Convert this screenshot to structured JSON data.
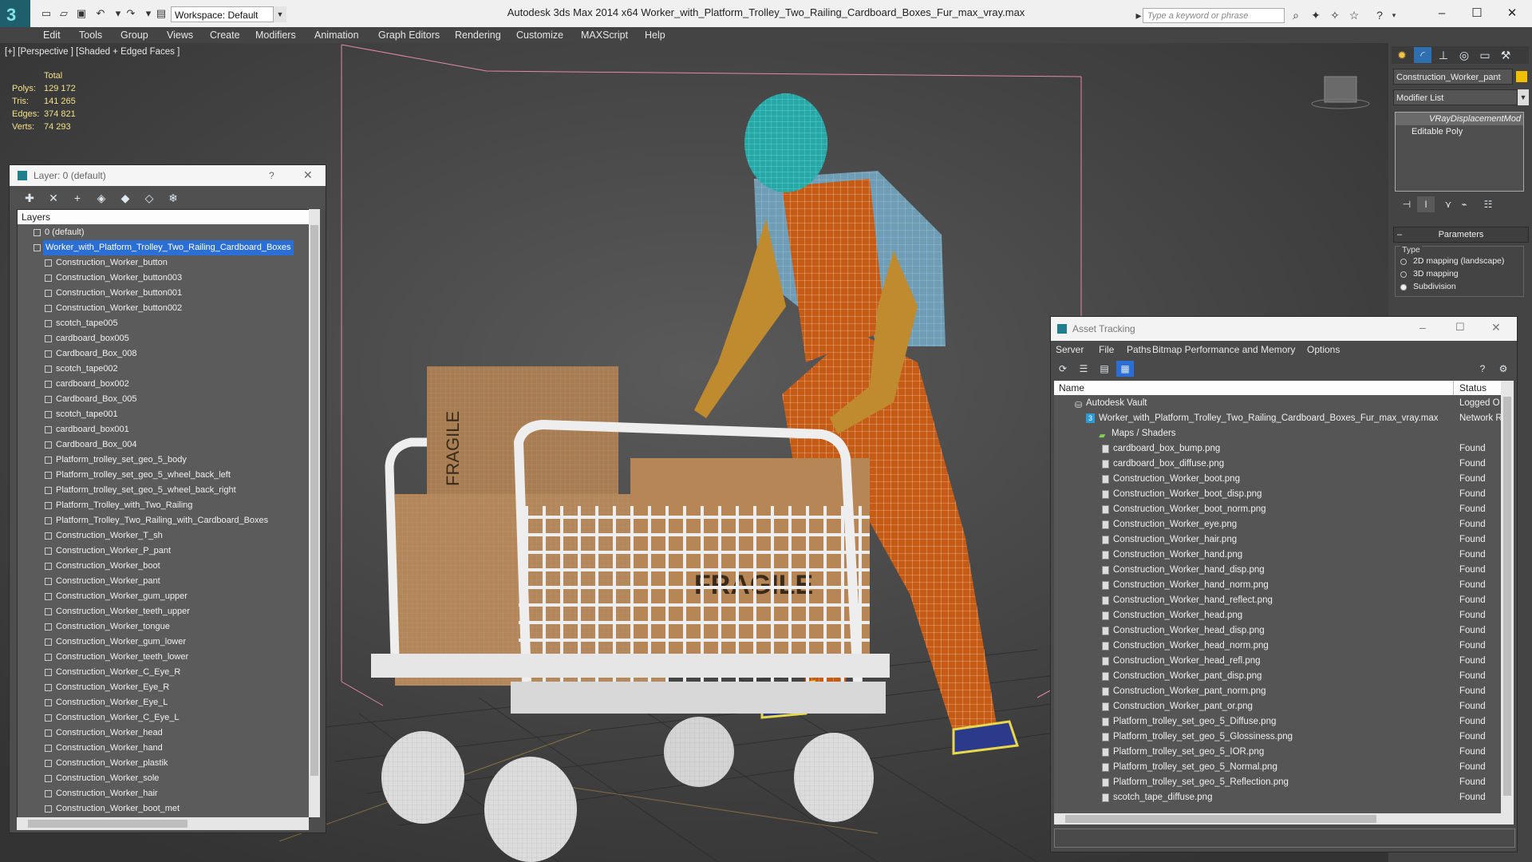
{
  "app": {
    "title": "Autodesk 3ds Max  2014 x64      Worker_with_Platform_Trolley_Two_Railing_Cardboard_Boxes_Fur_max_vray.max",
    "workspace": "Workspace: Default",
    "search_placeholder": "Type a keyword or phrase"
  },
  "menu": [
    "Edit",
    "Tools",
    "Group",
    "Views",
    "Create",
    "Modifiers",
    "Animation",
    "Graph Editors",
    "Rendering",
    "Customize",
    "MAXScript",
    "Help"
  ],
  "viewport": {
    "label": "[+] [Perspective ] [Shaded + Edged Faces ]",
    "stats": {
      "total": "Total",
      "rows": [
        {
          "label": "Polys:",
          "value": "129 172"
        },
        {
          "label": "Tris:",
          "value": "141 265"
        },
        {
          "label": "Edges:",
          "value": "374 821"
        },
        {
          "label": "Verts:",
          "value": "74 293"
        }
      ]
    },
    "box_text": "FRAGILE"
  },
  "layers_panel": {
    "title": "Layer: 0 (default)",
    "help": "?",
    "header": "Layers",
    "default_layer": "0 (default)",
    "selected_layer": "Worker_with_Platform_Trolley_Two_Railing_Cardboard_Boxes",
    "items": [
      "Construction_Worker_button",
      "Construction_Worker_button003",
      "Construction_Worker_button001",
      "Construction_Worker_button002",
      "scotch_tape005",
      "cardboard_box005",
      "Cardboard_Box_008",
      "scotch_tape002",
      "cardboard_box002",
      "Cardboard_Box_005",
      "scotch_tape001",
      "cardboard_box001",
      "Cardboard_Box_004",
      "Platform_trolley_set_geo_5_body",
      "Platform_trolley_set_geo_5_wheel_back_left",
      "Platform_trolley_set_geo_5_wheel_back_right",
      "Platform_Trolley_with_Two_Railing",
      "Platform_Trolley_Two_Railing_with_Cardboard_Boxes",
      "Construction_Worker_T_sh",
      "Construction_Worker_P_pant",
      "Construction_Worker_boot",
      "Construction_Worker_pant",
      "Construction_Worker_gum_upper",
      "Construction_Worker_teeth_upper",
      "Construction_Worker_tongue",
      "Construction_Worker_gum_lower",
      "Construction_Worker_teeth_lower",
      "Construction_Worker_C_Eye_R",
      "Construction_Worker_Eye_R",
      "Construction_Worker_Eye_L",
      "Construction_Worker_C_Eye_L",
      "Construction_Worker_head",
      "Construction_Worker_hand",
      "Construction_Worker_plastik",
      "Construction_Worker_sole",
      "Construction_Worker_hair",
      "Construction_Worker_boot_met"
    ]
  },
  "command_panel": {
    "object_name": "Construction_Worker_pant",
    "modifier_list": "Modifier List",
    "stack": [
      "VRayDisplacementMod",
      "Editable Poly"
    ],
    "rollout_title": "Parameters",
    "type_label": "Type",
    "options": [
      "2D mapping (landscape)",
      "3D mapping",
      "Subdivision"
    ],
    "selected_option": "Subdivision"
  },
  "asset_tracking": {
    "title": "Asset Tracking",
    "menu": [
      "Server",
      "File",
      "Paths",
      "Bitmap Performance and Memory",
      "Options"
    ],
    "columns": {
      "name": "Name",
      "status": "Status"
    },
    "vault": {
      "name": "Autodesk Vault",
      "status": "Logged O"
    },
    "scene_file": {
      "name": "Worker_with_Platform_Trolley_Two_Railing_Cardboard_Boxes_Fur_max_vray.max",
      "status": "Network R"
    },
    "group": "Maps / Shaders",
    "files": [
      {
        "name": "cardboard_box_bump.png",
        "status": "Found"
      },
      {
        "name": "cardboard_box_diffuse.png",
        "status": "Found"
      },
      {
        "name": "Construction_Worker_boot.png",
        "status": "Found"
      },
      {
        "name": "Construction_Worker_boot_disp.png",
        "status": "Found"
      },
      {
        "name": "Construction_Worker_boot_norm.png",
        "status": "Found"
      },
      {
        "name": "Construction_Worker_eye.png",
        "status": "Found"
      },
      {
        "name": "Construction_Worker_hair.png",
        "status": "Found"
      },
      {
        "name": "Construction_Worker_hand.png",
        "status": "Found"
      },
      {
        "name": "Construction_Worker_hand_disp.png",
        "status": "Found"
      },
      {
        "name": "Construction_Worker_hand_norm.png",
        "status": "Found"
      },
      {
        "name": "Construction_Worker_hand_reflect.png",
        "status": "Found"
      },
      {
        "name": "Construction_Worker_head.png",
        "status": "Found"
      },
      {
        "name": "Construction_Worker_head_disp.png",
        "status": "Found"
      },
      {
        "name": "Construction_Worker_head_norm.png",
        "status": "Found"
      },
      {
        "name": "Construction_Worker_head_refl.png",
        "status": "Found"
      },
      {
        "name": "Construction_Worker_pant_disp.png",
        "status": "Found"
      },
      {
        "name": "Construction_Worker_pant_norm.png",
        "status": "Found"
      },
      {
        "name": "Construction_Worker_pant_or.png",
        "status": "Found"
      },
      {
        "name": "Platform_trolley_set_geo_5_Diffuse.png",
        "status": "Found"
      },
      {
        "name": "Platform_trolley_set_geo_5_Glossiness.png",
        "status": "Found"
      },
      {
        "name": "Platform_trolley_set_geo_5_IOR.png",
        "status": "Found"
      },
      {
        "name": "Platform_trolley_set_geo_5_Normal.png",
        "status": "Found"
      },
      {
        "name": "Platform_trolley_set_geo_5_Reflection.png",
        "status": "Found"
      },
      {
        "name": "scotch_tape_diffuse.png",
        "status": "Found"
      }
    ]
  },
  "colors": {
    "accent": "#2b6fd6",
    "stats_text": "#f3e08a",
    "wire_cyan": "#3fd3d0",
    "overalls": "#c85a10",
    "box": "#b78656"
  }
}
